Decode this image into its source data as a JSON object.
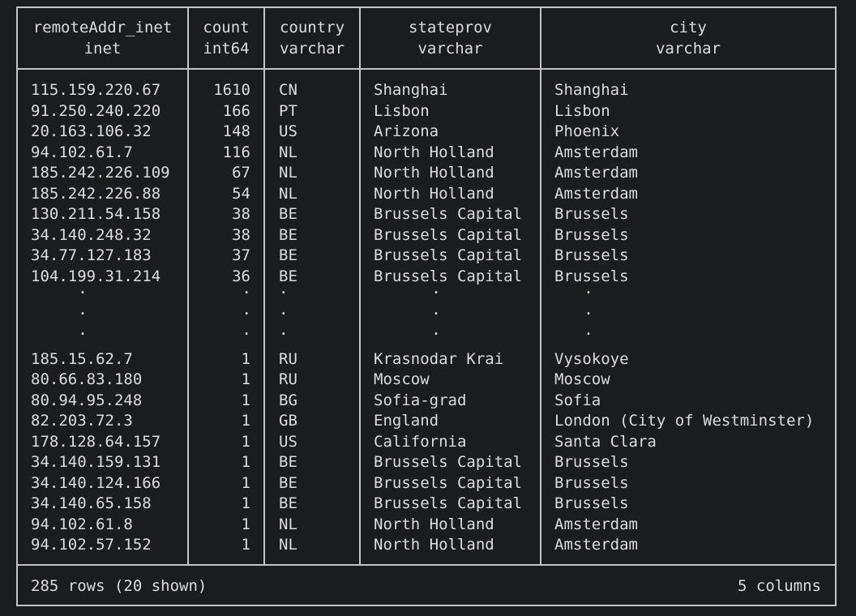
{
  "table": {
    "columns": [
      {
        "name": "remoteAddr_inet",
        "type": "inet"
      },
      {
        "name": "count",
        "type": "int64"
      },
      {
        "name": "country",
        "type": "varchar"
      },
      {
        "name": "stateprov",
        "type": "varchar"
      },
      {
        "name": "city",
        "type": "varchar"
      }
    ],
    "rows_top": [
      [
        "115.159.220.67",
        "1610",
        "CN",
        "Shanghai",
        "Shanghai"
      ],
      [
        "91.250.240.220",
        "166",
        "PT",
        "Lisbon",
        "Lisbon"
      ],
      [
        "20.163.106.32",
        "148",
        "US",
        "Arizona",
        "Phoenix"
      ],
      [
        "94.102.61.7",
        "116",
        "NL",
        "North Holland",
        "Amsterdam"
      ],
      [
        "185.242.226.109",
        "67",
        "NL",
        "North Holland",
        "Amsterdam"
      ],
      [
        "185.242.226.88",
        "54",
        "NL",
        "North Holland",
        "Amsterdam"
      ],
      [
        "130.211.54.158",
        "38",
        "BE",
        "Brussels Capital",
        "Brussels"
      ],
      [
        "34.140.248.32",
        "38",
        "BE",
        "Brussels Capital",
        "Brussels"
      ],
      [
        "34.77.127.183",
        "37",
        "BE",
        "Brussels Capital",
        "Brussels"
      ],
      [
        "104.199.31.214",
        "36",
        "BE",
        "Brussels Capital",
        "Brussels"
      ]
    ],
    "ellipsis": ".",
    "rows_bottom": [
      [
        "185.15.62.7",
        "1",
        "RU",
        "Krasnodar Krai",
        "Vysokoye"
      ],
      [
        "80.66.83.180",
        "1",
        "RU",
        "Moscow",
        "Moscow"
      ],
      [
        "80.94.95.248",
        "1",
        "BG",
        "Sofia-grad",
        "Sofia"
      ],
      [
        "82.203.72.3",
        "1",
        "GB",
        "England",
        "London (City of Westminster)"
      ],
      [
        "178.128.64.157",
        "1",
        "US",
        "California",
        "Santa Clara"
      ],
      [
        "34.140.159.131",
        "1",
        "BE",
        "Brussels Capital",
        "Brussels"
      ],
      [
        "34.140.124.166",
        "1",
        "BE",
        "Brussels Capital",
        "Brussels"
      ],
      [
        "34.140.65.158",
        "1",
        "BE",
        "Brussels Capital",
        "Brussels"
      ],
      [
        "94.102.61.8",
        "1",
        "NL",
        "North Holland",
        "Amsterdam"
      ],
      [
        "94.102.57.152",
        "1",
        "NL",
        "North Holland",
        "Amsterdam"
      ]
    ],
    "footer": {
      "rows_text": "285 rows (20 shown)",
      "columns_text": "5 columns"
    }
  },
  "colors": {
    "background": "#1b1c1e",
    "text": "#dcdcdc",
    "border": "#c4c4c4"
  }
}
